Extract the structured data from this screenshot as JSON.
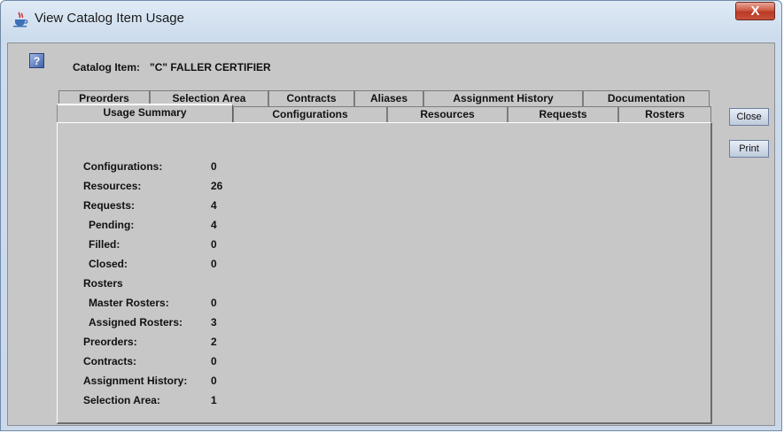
{
  "window": {
    "title": "View Catalog Item Usage",
    "close_label": "X"
  },
  "catalog": {
    "label": "Catalog Item:",
    "value": "\"C\" FALLER CERTIFIER"
  },
  "tabs_back": [
    "Preorders",
    "Selection Area",
    "Contracts",
    "Aliases",
    "Assignment History",
    "Documentation"
  ],
  "tabs_front": [
    "Usage Summary",
    "Configurations",
    "Resources",
    "Requests",
    "Rosters"
  ],
  "active_tab": "Usage Summary",
  "summary": [
    {
      "label": "Configurations:",
      "value": "0"
    },
    {
      "label": "Resources:",
      "value": "26"
    },
    {
      "label": "Requests:",
      "value": "4"
    },
    {
      "label": "Pending:",
      "value": "4"
    },
    {
      "label": "Filled:",
      "value": "0"
    },
    {
      "label": "Closed:",
      "value": "0"
    },
    {
      "label": "Rosters",
      "value": ""
    },
    {
      "label": "Master Rosters:",
      "value": "0"
    },
    {
      "label": "Assigned Rosters:",
      "value": "3"
    },
    {
      "label": "Preorders:",
      "value": "2"
    },
    {
      "label": "Contracts:",
      "value": "0"
    },
    {
      "label": "Assignment History:",
      "value": "0"
    },
    {
      "label": "Selection Area:",
      "value": "1"
    }
  ],
  "buttons": {
    "close": "Close",
    "print": "Print"
  },
  "icons": {
    "app": "java-cup-icon",
    "help": "help-icon",
    "close": "close-icon"
  }
}
